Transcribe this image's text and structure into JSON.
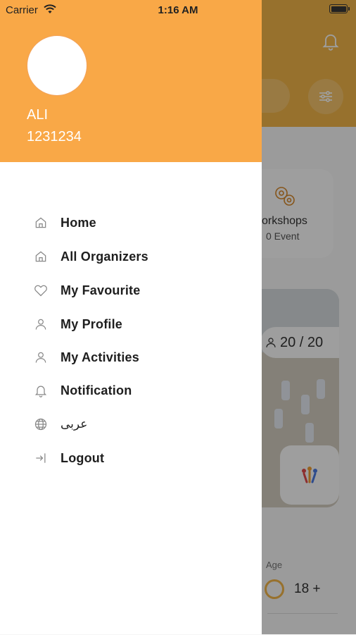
{
  "status_bar": {
    "carrier": "Carrier",
    "time": "1:16 AM"
  },
  "user": {
    "name": "ALI",
    "id": "1231234"
  },
  "menu": {
    "items": [
      {
        "label": "Home",
        "icon": "home-icon"
      },
      {
        "label": "All Organizers",
        "icon": "home-icon"
      },
      {
        "label": "My Favourite",
        "icon": "heart-icon"
      },
      {
        "label": "My Profile",
        "icon": "user-icon"
      },
      {
        "label": "My Activities",
        "icon": "user-icon"
      },
      {
        "label": "Notification",
        "icon": "bell-icon"
      },
      {
        "label": "عربى",
        "icon": "globe-icon"
      },
      {
        "label": "Logout",
        "icon": "logout-icon"
      }
    ]
  },
  "background": {
    "category_card": {
      "title": "orkshops",
      "subtitle": "0 Event"
    },
    "event_card": {
      "capacity": "20 / 20",
      "age_label": "Age",
      "age_value": "18 +"
    }
  },
  "colors": {
    "accent": "#f9a847",
    "header_bg": "#f4b64a"
  }
}
